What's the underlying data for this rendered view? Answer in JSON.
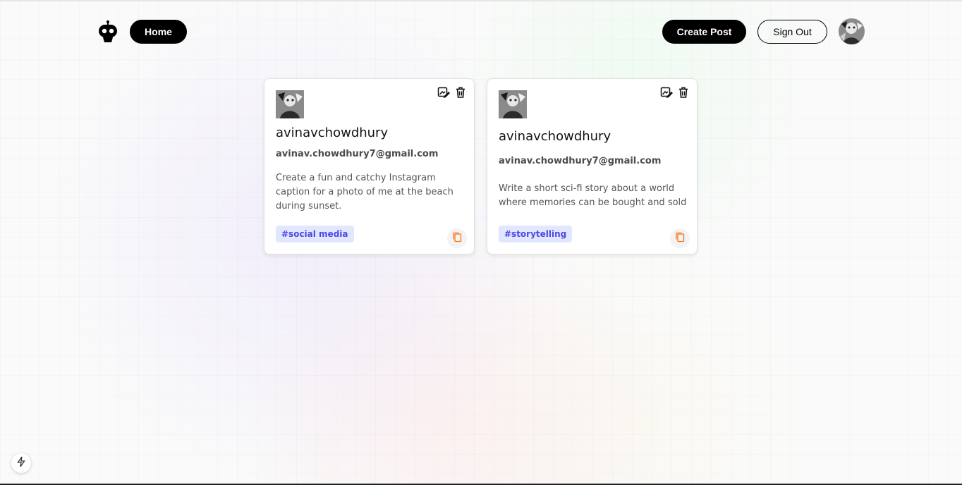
{
  "nav": {
    "home_label": "Home",
    "create_label": "Create Post",
    "signout_label": "Sign Out"
  },
  "icons": {
    "logo": "robot-icon",
    "edit": "edit-icon",
    "delete": "trash-icon",
    "copy": "copy-icon",
    "corner": "lightning-icon"
  },
  "colors": {
    "primary": "#000000",
    "tag_bg": "#e0e7ff",
    "tag_text": "#4f46e5",
    "copy_icon": "#f97316"
  },
  "posts": [
    {
      "username": "avinavchowdhury",
      "email": "avinav.chowdhury7@gmail.com",
      "prompt": "Create a fun and catchy Instagram caption for a photo of me at the beach during sunset.",
      "tag": "#social media"
    },
    {
      "username": "avinavchowdhury",
      "email": "avinav.chowdhury7@gmail.com",
      "prompt": "Write a short sci-fi story about a world where memories can be bought and sold",
      "tag": "#storytelling"
    }
  ]
}
